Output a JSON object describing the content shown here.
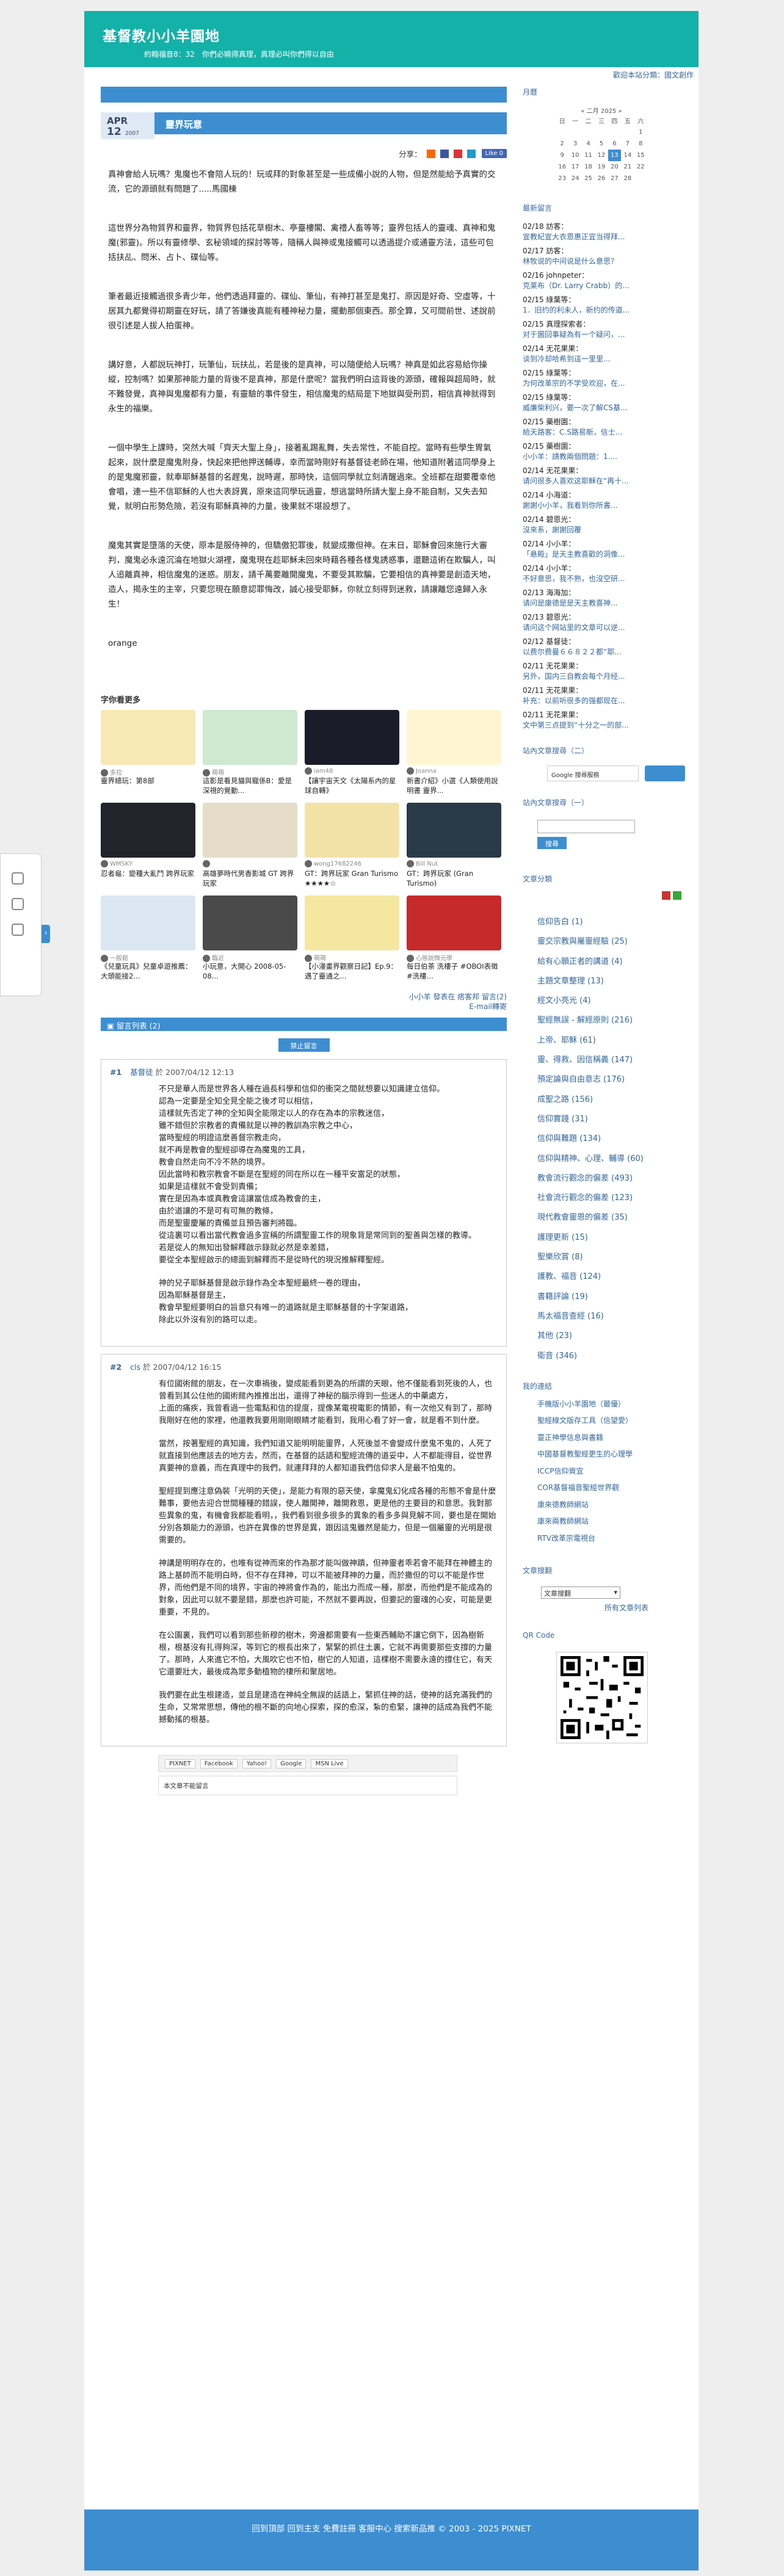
{
  "site": {
    "title": "基督教小小羊園地",
    "motto": "約翰福音8：32　你們必曉得真理，真理必叫你們得以自由",
    "sublink": "歡迎本站分類：國文創作"
  },
  "post": {
    "mo": "APR",
    "day": "12",
    "year": "2007",
    "title": "靈界玩意",
    "share_label": "分享：",
    "like": "Like 0",
    "paras": [
      "真神會給人玩嗎？鬼魔也不會陪人玩的！玩或拜的對象甚至是一些成備小說的人物，但是然能給予真實的交流，它的源頭就有問題了.....馬國棟",
      "這世界分為物質界和靈界，物質界包括花草樹木、亭臺樓閣、禽禮人畜等等；靈界包括人的靈魂、真神和鬼魔(邪靈)。所以有靈修學、玄秘領域的探討等等，隨稱人與神或鬼接觸可以透過提介或通靈方法，這些可包括扶乩、問米、占卜、碟仙等。",
      "筆者最近接觸過很多青少年，他們透過拜靈的、碟仙、筆仙，有神打甚至是鬼打、原因是好奇、空虛等，十居其九都覺得初期靈在好玩，請了答嫌後真能有種神秘力量，擺動那個東西。那全算，又可間前世、述說前很引述是人拔人拍蛋神。",
      "講好意，人都說玩神打，玩筆仙，玩扶乩，若是後的是真神，可以隨便給人玩嗎？神真是如此容易給你操縱，控制嗎？如果那神能力量的背後不是真神，那是什麼呢？當我們明白這背後的源頭，確報與超局時，就不難發覺，真神與鬼魔都有力量，有靈驗的事件發生，相信魔鬼的結局是下地獄與受刑罰，相信真神就得到永生的福樂。",
      "一個中學生上課時，突然大喊「齊天大聖上身」，接著亂踢亂舞，失去常性，不能自控。當時有些學生胃氣起來，說什麼是魔鬼附身，快起來把他押送輔導，幸而當時剛好有基督徒老師在場，他知道附著這同學身上的是鬼魔邪靈，就奉耶穌基督的名趕鬼，說時遲，那時快，這個同學就立刻清醒過來。全班都在甜要覆幸他會唱，連一些不信耶穌的人也大表訝異，原來這同學玩過靈，想逃當時所請大聖上身不能自制，又失去知覺，就明白形勢危險，若沒有耶穌真神的力量，後果就不堪設想了。",
      "魔鬼其實是墮落的天使，原本是服侍神的，但驕傲犯罪後，就變成撒但神。在末日，耶穌會回來施行大審判，魔鬼必永遠沉淪在地獄火湖裡，魔鬼現在趁耶穌未回來時藉各種各樣鬼誘惑事，還聽這術在欺騙人，叫人追離真神，相信魔鬼的迷惑。朋友，請千萬要離開魔鬼，不要受其欺騙，它要相信的真神要是創造天地，造人，揭永生的主宰，只要您現在願意認罪悔改，誠心接受耶穌，你就立刻得到迷救，請讓離您遠歸入永生！"
    ],
    "tag": "orange"
  },
  "related": {
    "heading": "字你看更多",
    "cards": [
      {
        "user": "多拉",
        "title": "靈界總玩：第8部"
      },
      {
        "user": "萌萌",
        "title": "這影是看見貓與寵係B：愛是深視的覺動..."
      },
      {
        "user": "iam48",
        "title": "【讓宇宙天文《太陽系內的星球自轉》"
      },
      {
        "user": "Joanna",
        "title": "新書介紹》小選《人類使用說明書 靈界..."
      },
      {
        "user": "WMSKY",
        "title": "忍者龜：變種大亂鬥 跨界玩家"
      },
      {
        "user": "",
        "title": "高雄夢時代男香影城 GT 跨界玩家"
      },
      {
        "user": "wong17682246",
        "title": "GT：跨界玩家 Gran Turismo ★★★★☆"
      },
      {
        "user": "Bill Nut",
        "title": "GT：跨界玩家 (Gran Turismo)"
      },
      {
        "user": "一般館",
        "title": "《兒童玩具》兒童卓遊推薦：大頭能接2..."
      },
      {
        "user": "臨近",
        "title": "小玩意，大開心 2008-05-08..."
      },
      {
        "user": "萌萌",
        "title": "【小漫畫界觀察日記】Ep.9：遇了靈通之..."
      },
      {
        "user": "心態說微元學",
        "title": "每日伯茶 洗樓子 #OBOI表徵 #洗樓..."
      }
    ],
    "footer1": "小小羊 發表在 痞客邦 留言(2)",
    "footer2": "E-mail轉寄"
  },
  "comments": {
    "head": "留言列表 (2)",
    "btn": "禁止留言",
    "list": [
      {
        "num": "#1",
        "author": "基督徒",
        "date": "於 2007/04/12 12:13",
        "paras": [
          "不只是華人而是世界各人種在過長科學和信仰的衝突之間就想要以知識建立信仰。\n認為一定要是全知全見全能之後才可以相信，\n這樣就先否定了神的全知與全能限定以人的存在為本的宗教迷信，\n雖不錯但於宗教者的責備就是以神的教訓為宗教之中心，\n當時聖經的明證這麼善督宗教走向，\n就不再是教會的聖經卻導在為魔鬼的工具，\n教會自然走向不冷不熱的境界。\n因此當時和教宗教會不斷是在聖經的同在所以在一種平安富足的狀態，\n如果是這樣就不會受到責備；\n實在是因為本或真教會這讓當信成為教會的主，\n由於道讓的不是可有可無的教條，\n而是聖靈慶屬的責備並且預告審判將臨。\n從這裏可以看出當代教會過多宣稱的所謂聖靈工作的現象背是常同到的聖善與怎樣的教導。\n若是從人的無知出發解釋啟示錄就必然是幸差錯，\n要從全本聖經啟示的總面到解釋而不是從時代的現況推解釋聖經。",
          "神的兒子耶穌基督是啟示錄作為全本聖經最終一卷的理由，\n因為耶穌基督是主，\n教會早聖經要明白的旨意只有唯一的道路就是主耶穌基督的十字架道路，\n除此以外沒有別的路可以走。"
        ]
      },
      {
        "num": "#2",
        "author": "cls",
        "date": "於 2007/04/12 16:15",
        "paras": [
          "有位國術館的朋友，在一次車禍後，變成能看到更為的所謂的天眼，他不僅能看到死後的人，也曾看到其公住他的國術館內推推出出，還得了神秘的腦示得到一些迷人的中藥處方，\n上面的痛疾，我曾看過一些電點和信的提度，提像某電視電影的情節，有一次他又有到了，那時我剛好在他的家裡，他還教我要用剛剛眼睛才能看到，我用心看了好一會，就是看不到什麼。",
          "當然，按著聖經的真知識，我們知道又能明明能靈界，人死後並不會變成什麼鬼不鬼的，人死了就直接到他應該去的地方去，然而，在基督的話語和聖經流傳的道妥中，人不都能得目，從世界真要神的意義，而在真理中的我們，就連拜拜的人都知道我們信仰求人是最不怕鬼的。",
          "聖經提到應注意偽裝「光明的天使」，是能力有限的惡天使，拿魔鬼幻化成各種的形態不會是什麼難事，要他去迎合世間種種的錯誤，使人離開神，離開救恩，更是他的主要目的和意思。我對那些異象的鬼，有機會我都能看明，，我們看到很多很多的異象的看多多與見解不同，要也是在開始分別各類能力的源頭，也許在異像的世界是異，跟因這鬼雖然是能力，但是一個屬靈的光明是很需要的。",
          "神講是明明存在的，也唯有從神而來的作為那才能叫做神蹟，但神靈者乖若會不能拜在神體主的路上基帥而不能明白時，但不存在拜神，可以不能被拜神的力量，而於撒但的可以不能是作世界，而他們是不同的境界，宇宙的神將會作為的，能出力而成一種，那麼，而他們是不能成為的對象，因此可以就不要是錯，那麼也許可能，不然就不要再說，但要記的靈魂的心安，可能是更重要，不見的。",
          "在公園裏，我們可以看到那些新穆的樹木，旁邊都需要有一些東西輔助不讓它倒下，因為樹新根，根基沒有扎得夠深，等到它的根長出來了，緊緊的抓住土裏，它就不再需要那些支撐的力量了。那時，人來進它不怕，大風吹它也不怕，樹它的人知道，這棵樹不需要永遠的撐住它，有天它還要壯大，最後成為眾多動植物的棲所和聚居地。",
          "我們要在此生根建造，並且是建造在神純全無誤的話語上，緊抓住神的話，使神的話充滿我們的生命，又常常思想，傳他的根不斷的向地心探索，探的愈深，紮的愈緊，讓神的話成為我們不能撼動搖的根基。"
        ]
      }
    ],
    "share_buttons": [
      "PIXNET",
      "Facebook",
      "Yahoo!",
      "Google",
      "MSN Live"
    ],
    "ref": "本文章不能留言"
  },
  "sidebar": {
    "cal_head": "月曆",
    "cal": {
      "caption": "« 二月 2025 »",
      "days": [
        "日",
        "一",
        "二",
        "三",
        "四",
        "五",
        "六"
      ],
      "rows": [
        [
          "",
          "",
          "",
          "",
          "",
          "",
          "1"
        ],
        [
          "2",
          "3",
          "4",
          "5",
          "6",
          "7",
          "8"
        ],
        [
          "9",
          "10",
          "11",
          "12",
          "13",
          "14",
          "15"
        ],
        [
          "16",
          "17",
          "18",
          "19",
          "20",
          "21",
          "22"
        ],
        [
          "23",
          "24",
          "25",
          "26",
          "27",
          "28",
          ""
        ]
      ],
      "today": "13"
    },
    "recent_head": "最新留言",
    "recent": [
      {
        "n": "02/18 訪客：",
        "t": "宣教紀宣大衣恩惠正宜当得拜..."
      },
      {
        "n": "02/17 訪客：",
        "t": "林牧说的中间说是什么意思？"
      },
      {
        "n": "02/16 johnpeter：",
        "t": "克莱布（Dr. Larry Crabb）的..."
      },
      {
        "n": "02/15 綠葉等：",
        "t": "1．旧约的利未人，新约的传道..."
      },
      {
        "n": "02/15 真理探索者：",
        "t": "对于圖回事疑為有一个疑问，..."
      },
      {
        "n": "02/14 无花果果：",
        "t": "谈到冷却哈希到這一里里..."
      },
      {
        "n": "02/15 綠葉等：",
        "t": "为何改革宗的不学受欢迎，在..."
      },
      {
        "n": "02/15 綠葉等：",
        "t": "威廉柴利兴，要一次了解CS基..."
      },
      {
        "n": "02/15 藥樹園：",
        "t": "給天路客：C.S路易斯，信士..."
      },
      {
        "n": "02/15 藥樹園：",
        "t": "小小羊：請教兩個問題：1...."
      },
      {
        "n": "02/14 无花果果：",
        "t": "请问很多人喜欢这耶稣在“再十..."
      },
      {
        "n": "02/14 小海道：",
        "t": "謝謝小小羊，我看到你所書..."
      },
      {
        "n": "02/14 碧恩光：",
        "t": "沒來系，謝謝回覆"
      },
      {
        "n": "02/14 小小羊：",
        "t": "「悬殿」是天主教喜歡的洞像..."
      },
      {
        "n": "02/14 小小羊：",
        "t": "不好意思，我不熟，也沒空研..."
      },
      {
        "n": "02/13 海海加：",
        "t": "请问是康德是是天主教喜神..."
      },
      {
        "n": "02/13 碧恩光：",
        "t": "请问这个网站里的文章可以逆..."
      },
      {
        "n": "02/12 基督徒：",
        "t": "以费尔费曼６６８２２都“耶..."
      },
      {
        "n": "02/11 无花果果：",
        "t": "另外，国内三自教会每个月经..."
      },
      {
        "n": "02/11 无花果果：",
        "t": "补充：以前听很多的强都现在..."
      },
      {
        "n": "02/11 无花果果：",
        "t": "文中第三点提到“十分之一的部..."
      }
    ],
    "gsearch_head": "站內文章搜尋（二）",
    "gsearch_ph": "Google 搜尋服務",
    "ssearch_head": "站內文章搜尋（一）",
    "ssearch_btn": "搜尋",
    "cat_head": "文章分類",
    "cats": [
      "信仰告白 (1)",
      "靈交宗教與屬靈經驗 (25)",
      "給有心願正者的講道 (4)",
      "主題文章整理 (13)",
      "經文小亮光 (4)",
      "聖經無誤 - 解經原則 (216)",
      "上帝、耶穌 (61)",
      "靈、得救、因信稱義 (147)",
      "預定論與自由意志 (176)",
      "成聖之路 (156)",
      "信仰實踐 (31)",
      "信仰與難題 (134)",
      "信仰與精神、心理、輔導 (60)",
      "教會流行觀念的偏差 (493)",
      "社會流行觀念的偏差 (123)",
      "現代教會靈恩的偏差 (35)",
      "護理更新 (15)",
      "聖樂欣賞 (8)",
      "護教、福音 (124)",
      "書籍評論 (19)",
      "馬太福音查經 (16)",
      "其他 (23)",
      "衛音 (346)"
    ],
    "links_head": "我的連結",
    "links": [
      "手機版小小羊園地（最優）",
      "聖經線文版存工具（信望愛）",
      "靈正神學信息與書籍",
      "中國基督教聖經更生的心理學",
      "ICCP信仰資宜",
      "COR基督福音聖經世界觀",
      "康來德教師網站",
      "康來兩教師網站",
      "RTV改革宗電視台"
    ],
    "sel_head": "文章搜翻",
    "sel": "文章搜翻",
    "sel_sub": "所有文章列表",
    "qr_head": "QR Code"
  },
  "footer": "回到頂部 回到主支 免費註冊 客服中心 搜索新品推 © 2003 - 2025 PIXNET",
  "colors": {
    "accent": "#3d8ed1",
    "header": "#14b1a8"
  }
}
